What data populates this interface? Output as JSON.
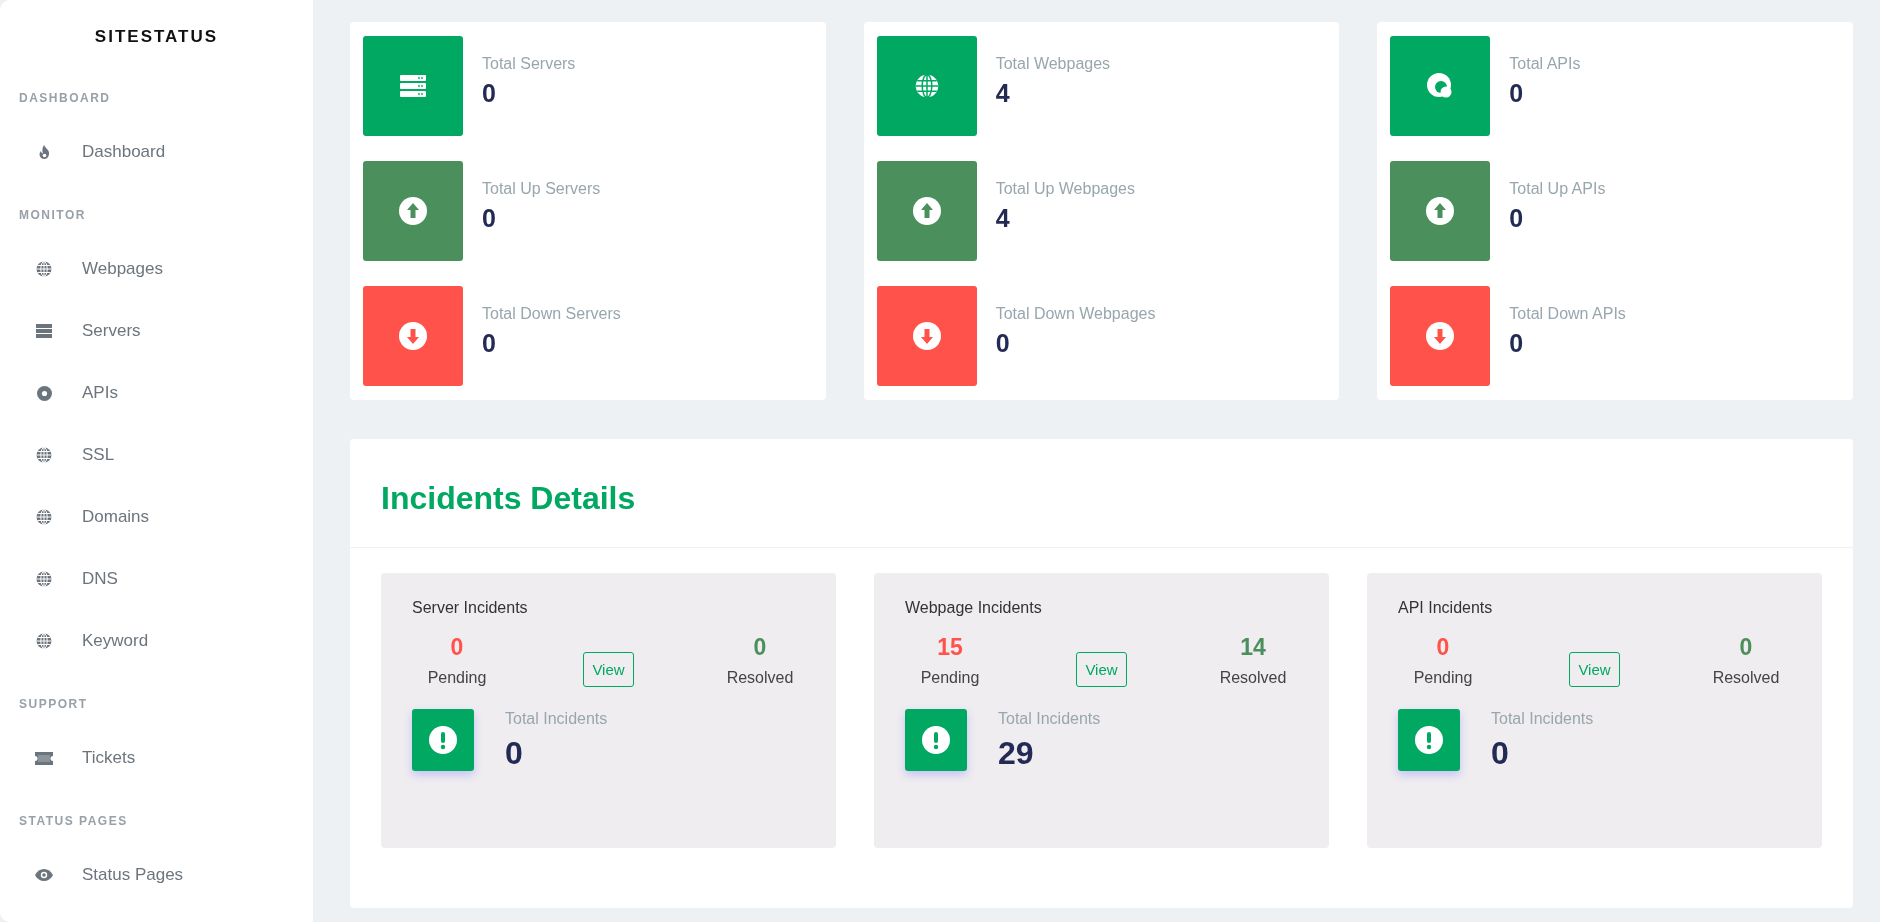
{
  "sidebar": {
    "brand": "SITESTATUS",
    "sections": [
      {
        "title": "DASHBOARD",
        "items": [
          {
            "label": "Dashboard",
            "kind": "flame"
          }
        ]
      },
      {
        "title": "MONITOR",
        "items": [
          {
            "label": "Webpages",
            "kind": "globe"
          },
          {
            "label": "Servers",
            "kind": "server"
          },
          {
            "label": "APIs",
            "kind": "disc"
          },
          {
            "label": "SSL",
            "kind": "globe"
          },
          {
            "label": "Domains",
            "kind": "globe"
          },
          {
            "label": "DNS",
            "kind": "globe"
          },
          {
            "label": "Keyword",
            "kind": "globe"
          }
        ]
      },
      {
        "title": "SUPPORT",
        "items": [
          {
            "label": "Tickets",
            "kind": "ticket"
          }
        ]
      },
      {
        "title": "STATUS PAGES",
        "items": [
          {
            "label": "Status Pages",
            "kind": "eye"
          }
        ]
      }
    ]
  },
  "stat_cards": [
    {
      "rows": [
        {
          "kind": "server",
          "label": "Total Servers",
          "value": "0"
        },
        {
          "kind": "up",
          "label": "Total Up Servers",
          "value": "0"
        },
        {
          "kind": "down",
          "label": "Total Down Servers",
          "value": "0"
        }
      ]
    },
    {
      "rows": [
        {
          "kind": "globe",
          "label": "Total Webpages",
          "value": "4"
        },
        {
          "kind": "up",
          "label": "Total Up Webpages",
          "value": "4"
        },
        {
          "kind": "down",
          "label": "Total Down Webpages",
          "value": "0"
        }
      ]
    },
    {
      "rows": [
        {
          "kind": "api",
          "label": "Total APIs",
          "value": "0"
        },
        {
          "kind": "up",
          "label": "Total Up APIs",
          "value": "0"
        },
        {
          "kind": "down",
          "label": "Total Down APIs",
          "value": "0"
        }
      ]
    }
  ],
  "incidents": {
    "title": "Incidents Details",
    "cards": [
      {
        "title": "Server Incidents",
        "pending": "0",
        "pending_label": "Pending",
        "view": "View",
        "resolved": "0",
        "resolved_label": "Resolved",
        "total_label": "Total Incidents",
        "total": "0"
      },
      {
        "title": "Webpage Incidents",
        "pending": "15",
        "pending_label": "Pending",
        "view": "View",
        "resolved": "14",
        "resolved_label": "Resolved",
        "total_label": "Total Incidents",
        "total": "29"
      },
      {
        "title": "API Incidents",
        "pending": "0",
        "pending_label": "Pending",
        "view": "View",
        "resolved": "0",
        "resolved_label": "Resolved",
        "total_label": "Total Incidents",
        "total": "0"
      }
    ]
  }
}
